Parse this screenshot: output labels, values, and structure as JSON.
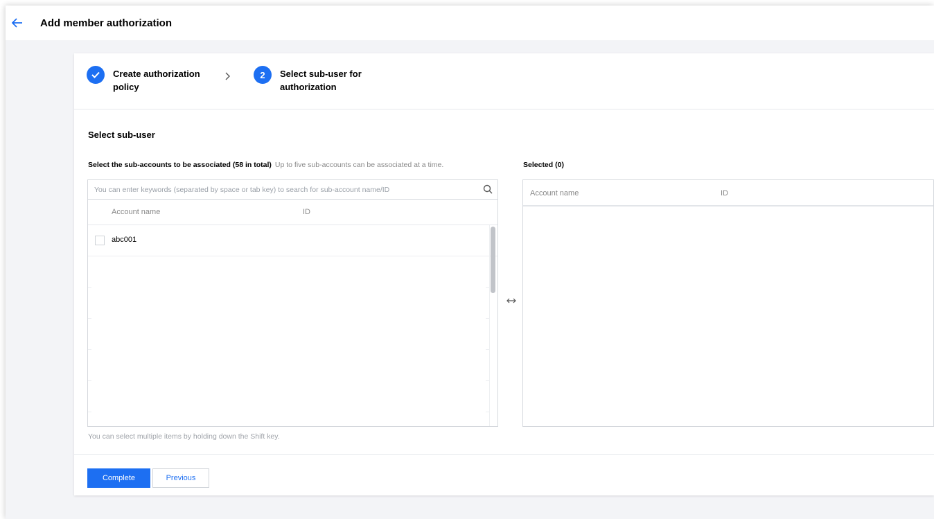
{
  "header": {
    "title": "Add member authorization"
  },
  "steps": [
    {
      "label_line1": "Create authorization",
      "label_line2": "policy",
      "status": "done"
    },
    {
      "number": "2",
      "label_line1": "Select sub-user for",
      "label_line2": "authorization",
      "status": "current"
    }
  ],
  "section": {
    "title": "Select sub-user"
  },
  "left_panel": {
    "title_bold": "Select the sub-accounts to be associated (58 in total)",
    "title_hint": "Up to five sub-accounts can be associated at a time.",
    "search_placeholder": "You can enter keywords (separated by space or tab key) to search for sub-account name/ID",
    "columns": [
      "Account name",
      "ID"
    ],
    "rows": [
      {
        "name": "abc001",
        "id": ""
      }
    ]
  },
  "right_panel": {
    "title": "Selected (0)",
    "columns": [
      "Account name",
      "ID"
    ]
  },
  "footnote": "You can select multiple items by holding down the Shift key.",
  "buttons": {
    "complete": "Complete",
    "previous": "Previous"
  },
  "colors": {
    "accent": "#1d6ff2",
    "background": "#f3f4f7"
  },
  "icons": {
    "back": "arrow-left-icon",
    "search": "search-icon",
    "transfer": "transfer-arrows-icon",
    "check": "check-icon",
    "step_separator": "chevron-right-icon"
  }
}
